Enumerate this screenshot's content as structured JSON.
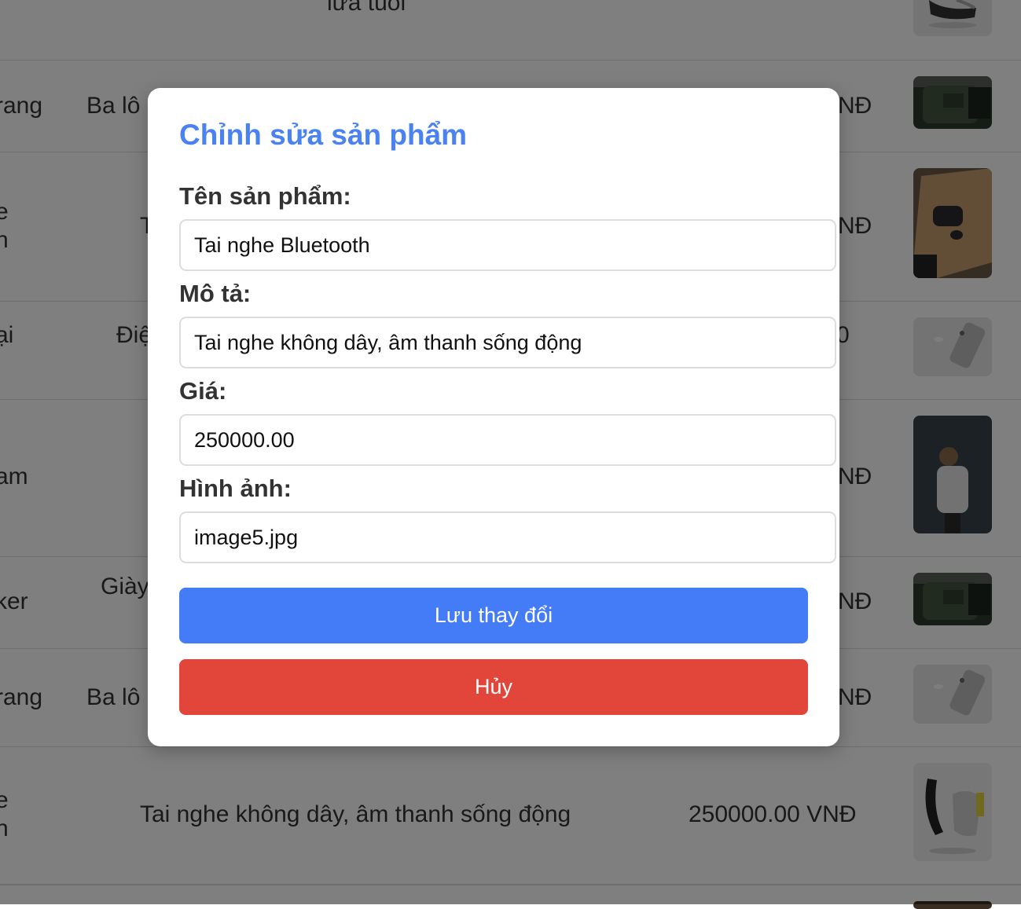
{
  "background_table": {
    "rows": [
      {
        "name_fragment": "",
        "type": "",
        "description": "lứa tuổi",
        "price": "",
        "image": "shoe"
      },
      {
        "name_fragment": "rang",
        "type": "Ba lô",
        "description": "",
        "price": "NĐ",
        "image": "backpack"
      },
      {
        "name_fragment_1": "e",
        "name_fragment_2": "h",
        "type": "T",
        "description": "",
        "price": "NĐ",
        "image": "earbuds"
      },
      {
        "name_fragment": "ại",
        "type": "Điệ",
        "description": "",
        "price": "0",
        "image": "phone"
      },
      {
        "name_fragment": "am",
        "type": "",
        "description": "",
        "price": "NĐ",
        "image": "person"
      },
      {
        "name_fragment": "ker",
        "type": "Giày",
        "description": "",
        "price": "NĐ",
        "image": "backpack"
      },
      {
        "name_fragment": "rang",
        "type": "Ba lô",
        "description": "",
        "price": "NĐ",
        "image": "phone"
      },
      {
        "name_fragment_1": "e",
        "name_fragment_2": "h",
        "type": "",
        "description": "Tai nghe không dây, âm thanh sống động",
        "price": "250000.00 VNĐ",
        "image": "shoe"
      }
    ]
  },
  "modal": {
    "title": "Chỉnh sửa sản phẩm",
    "fields": {
      "name": {
        "label": "Tên sản phẩm:",
        "value": "Tai nghe Bluetooth"
      },
      "description": {
        "label": "Mô tả:",
        "value": "Tai nghe không dây, âm thanh sống động"
      },
      "price": {
        "label": "Giá:",
        "value": "250000.00"
      },
      "image": {
        "label": "Hình ảnh:",
        "value": "image5.jpg"
      }
    },
    "save_label": "Lưu thay đổi",
    "cancel_label": "Hủy"
  },
  "colors": {
    "title_blue": "#4a82f0",
    "save_blue": "#437cf6",
    "cancel_red": "#e2453a",
    "overlay": "rgba(0,0,0,0.5)"
  }
}
